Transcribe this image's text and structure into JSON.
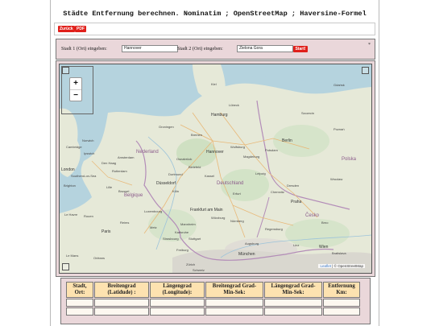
{
  "header": {
    "title": "Städte Entfernung berechnen. Nominatim ; OpenStreetMap ; Haversine-Formel"
  },
  "toolbar": {
    "back_label": "Zurück",
    "pdf_label": "PDF"
  },
  "form": {
    "city1_label": "Stadt 1 (Ort) eingeben:",
    "city1_value": "Hannover",
    "city2_label": "Stadt 2 (Ort) eingeben:",
    "city2_value": "Zielona Gora",
    "start_label": "Start!",
    "star": "*"
  },
  "map": {
    "zoom_in": "+",
    "zoom_out": "−",
    "attribution_leaflet": "Leaflet",
    "attribution_rest": " | © OpenStreetMap",
    "cities": [
      {
        "name": "Hamburg",
        "big": true
      },
      {
        "name": "Bremen",
        "big": true
      },
      {
        "name": "Berlin",
        "big": true
      },
      {
        "name": "Hannover",
        "big": true
      },
      {
        "name": "Amsterdam",
        "big": true
      },
      {
        "name": "Nederland",
        "big": false
      },
      {
        "name": "Düsseldorf",
        "big": true
      },
      {
        "name": "Köln",
        "big": false
      },
      {
        "name": "Deutschland",
        "big": true
      },
      {
        "name": "Leipzig",
        "big": false
      },
      {
        "name": "Dresden",
        "big": false
      },
      {
        "name": "Praha",
        "big": true
      },
      {
        "name": "Frankfurt am Main",
        "big": true
      },
      {
        "name": "Nürnberg",
        "big": false
      },
      {
        "name": "München",
        "big": true
      },
      {
        "name": "Paris",
        "big": true
      },
      {
        "name": "Wien",
        "big": true
      },
      {
        "name": "Bratislava",
        "big": false
      },
      {
        "name": "Zürich",
        "big": false
      },
      {
        "name": "London",
        "big": true
      },
      {
        "name": "Belgique",
        "big": false
      },
      {
        "name": "Luxembourg",
        "big": false
      },
      {
        "name": "Polska",
        "big": false
      },
      {
        "name": "Česko",
        "big": false
      },
      {
        "name": "Brno",
        "big": false
      },
      {
        "name": "Stuttgart",
        "big": false
      },
      {
        "name": "Poznań",
        "big": false
      },
      {
        "name": "Brussel",
        "big": false
      },
      {
        "name": "Wrocław",
        "big": false
      },
      {
        "name": "Lille",
        "big": false
      },
      {
        "name": "Rotterdam",
        "big": false
      },
      {
        "name": "Den Haag",
        "big": false
      },
      {
        "name": "Groningen",
        "big": false
      },
      {
        "name": "Szczecin",
        "big": false
      },
      {
        "name": "Lübeck",
        "big": false
      },
      {
        "name": "Kiel",
        "big": false
      },
      {
        "name": "Gdańsk",
        "big": false
      },
      {
        "name": "Augsburg",
        "big": false
      },
      {
        "name": "Regensburg",
        "big": false
      },
      {
        "name": "Mannheim",
        "big": false
      },
      {
        "name": "Linz",
        "big": false
      },
      {
        "name": "Schweiz",
        "big": false
      },
      {
        "name": "Cambridge",
        "big": false
      },
      {
        "name": "Norwich",
        "big": false
      },
      {
        "name": "Ipswich",
        "big": false
      },
      {
        "name": "Southend-on-Sea",
        "big": false
      },
      {
        "name": "Brighton",
        "big": false
      },
      {
        "name": "Le Havre",
        "big": false
      },
      {
        "name": "Rouen",
        "big": false
      },
      {
        "name": "Reims",
        "big": false
      },
      {
        "name": "Le Mans",
        "big": false
      },
      {
        "name": "Orléans",
        "big": false
      },
      {
        "name": "Metz",
        "big": false
      },
      {
        "name": "Freiburg",
        "big": false
      },
      {
        "name": "Bielefeld",
        "big": false
      },
      {
        "name": "Dortmund",
        "big": false
      },
      {
        "name": "Osnabrück",
        "big": false
      },
      {
        "name": "Wolfsburg",
        "big": false
      },
      {
        "name": "Magdeburg",
        "big": false
      },
      {
        "name": "Potsdam",
        "big": false
      },
      {
        "name": "Chemnitz",
        "big": false
      },
      {
        "name": "Kassel",
        "big": false
      },
      {
        "name": "Erfurt",
        "big": false
      },
      {
        "name": "Strasbourg",
        "big": false
      },
      {
        "name": "Karlsruhe",
        "big": false
      },
      {
        "name": "Würzburg",
        "big": false
      }
    ]
  },
  "table": {
    "headers": [
      "Stadt, Ort:",
      "Breitengrad (Latidude) :",
      "Längengrad (Longitude):",
      "Breitengrad Grad-Min-Sek:",
      "Längengrad Grad-Min-Sek:",
      "Entfernung Km:"
    ]
  },
  "colors": {
    "accent_red": "#e0201b",
    "panel_bg": "#ead7da",
    "header_bg": "#fde2b0",
    "sea": "#b5d3de",
    "land": "#e6e9d8"
  }
}
